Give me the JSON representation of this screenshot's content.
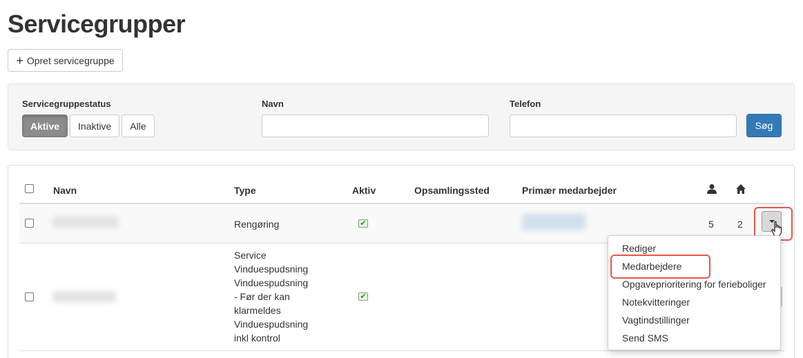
{
  "page": {
    "title": "Servicegrupper"
  },
  "toolbar": {
    "create_label": "Opret servicegruppe"
  },
  "filters": {
    "status_label": "Servicegruppestatus",
    "status_options": [
      "Aktive",
      "Inaktive",
      "Alle"
    ],
    "status_selected": "Aktive",
    "name_label": "Navn",
    "name_value": "",
    "phone_label": "Telefon",
    "phone_value": "",
    "search_label": "Søg"
  },
  "table": {
    "columns": [
      "Navn",
      "Type",
      "Aktiv",
      "Opsamlingssted",
      "Primær medarbejder"
    ],
    "rows": [
      {
        "type": "Rengøring",
        "active": true,
        "employees": "5",
        "homes": "2"
      },
      {
        "type": "Service\nVinduespudsning\nVinduespudsning\n- Før der kan\nklarmeldes\nVinduespudsning\ninkl kontrol",
        "active": true
      }
    ]
  },
  "dropdown": {
    "items": [
      "Rediger",
      "Medarbejdere",
      "Opgaveprioritering for ferieboliger",
      "Notekvitteringer",
      "Vagtindstillinger",
      "Send SMS"
    ],
    "highlighted": "Medarbejdere"
  },
  "colors": {
    "primary": "#337ab7",
    "active_toggle": "#8c8c8c",
    "highlight": "#e4574a",
    "check": "#2f8a2f"
  },
  "icons": {
    "user": "user-icon",
    "home": "home-icon",
    "plus": "plus-icon",
    "check": "check-icon",
    "caret": "caret-down-icon",
    "cursor": "hand-pointer-icon"
  }
}
